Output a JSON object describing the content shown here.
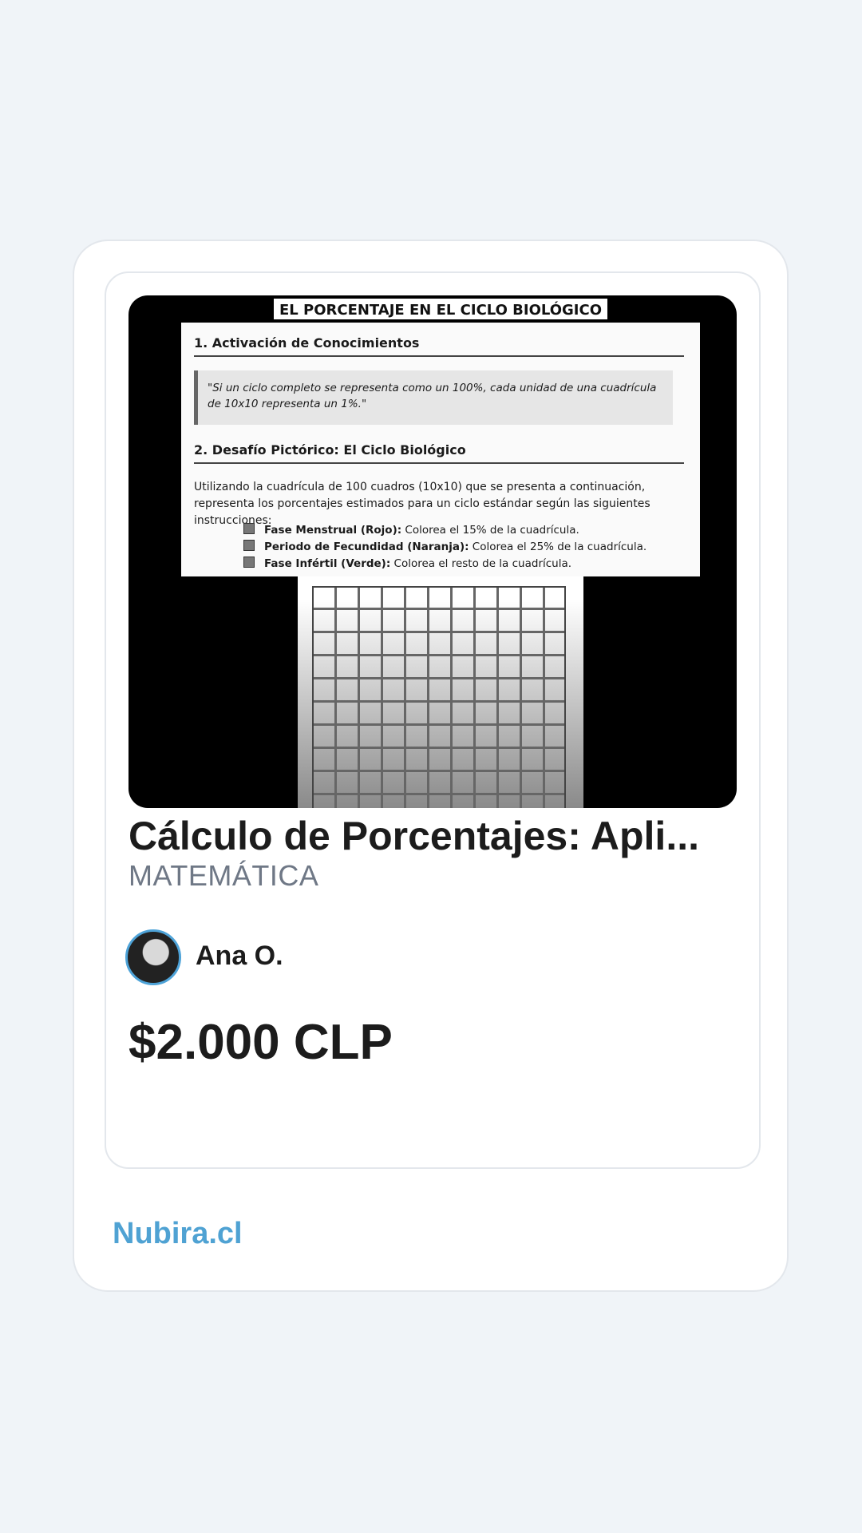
{
  "product": {
    "thumbnail": {
      "doc_title": "EL PORCENTAJE EN EL CICLO BIOLÓGICO",
      "section1": "1. Activación de Conocimientos",
      "quote": "\"Si un ciclo completo se representa como un 100%, cada unidad de una cuadrícula de 10x10 representa un 1%.\"",
      "section2": "2. Desafío Pictórico: El Ciclo Biológico",
      "intro": "Utilizando la cuadrícula de 100 cuadros (10x10) que se presenta a continuación, representa los porcentajes estimados para un ciclo estándar según las siguientes instrucciones:",
      "instructions": [
        {
          "bold": "Fase Menstrual (Rojo):",
          "text": " Colorea el 15% de la cuadrícula."
        },
        {
          "bold": "Periodo de Fecundidad (Naranja):",
          "text": " Colorea el 25% de la cuadrícula."
        },
        {
          "bold": "Fase Infértil (Verde):",
          "text": " Colorea el resto de la cuadrícula."
        }
      ]
    },
    "title": "Cálculo de Porcentajes: Apli...",
    "subject": "MATEMÁTICA",
    "author": "Ana O.",
    "price": "$2.000 CLP"
  },
  "brand": "Nubira.cl"
}
